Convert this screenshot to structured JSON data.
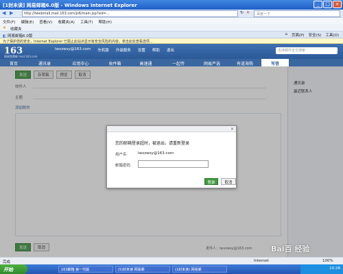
{
  "window": {
    "title": "[1封未读] 网易邮箱6.0版 - Windows Internet Explorer"
  },
  "address": {
    "url": "http://twebmail.mail.163.com/js6/main.jsp?sid=...",
    "search_placeholder": "百度一下"
  },
  "menu": [
    "文件(F)",
    "编辑(E)",
    "查看(V)",
    "收藏夹(A)",
    "工具(T)",
    "帮助(H)"
  ],
  "favorites": {
    "label": "收藏夹"
  },
  "tab": {
    "label": "网易邮箱6.0版"
  },
  "page_tools": [
    "页面(P)",
    "安全(S)",
    "工具(O)"
  ],
  "infobar": {
    "text": "为了保护您的安全，Internet Explorer 已阻止此站点显示有安全风险的内容。单击此处查看选项..."
  },
  "mail_header": {
    "logo": "163",
    "logo_sub": "网易免费邮 mail.163.com",
    "links": [
      "lwxzwsy@163.com",
      "车机版",
      "升级服务",
      "设置",
      "帮助",
      "退出"
    ],
    "search_placeholder": "支持邮件全文搜索"
  },
  "nav_tabs": [
    "首页",
    "通讯录",
    "应用中心",
    "收件箱",
    "高速通",
    "一起传",
    "网易严选",
    "有道海购",
    "写信"
  ],
  "compose": {
    "send": "发送",
    "save": "存草稿",
    "preview": "预览",
    "cancel": "取消",
    "to_label": "收件人",
    "subject_label": "主题",
    "attach_label": "添加附件",
    "sender_label": "发件人：",
    "sender_value": "lwxzwsy@163.com"
  },
  "sidebar": {
    "items": [
      "通讯录",
      "最近联系人"
    ]
  },
  "dialog": {
    "message": "您的邮箱登录超时，被退出，请重新登录",
    "user_label": "用户名",
    "user_value": "lwxzwsy@163.com",
    "password_label": "邮箱密码",
    "ok": "登录",
    "cancel": "取消"
  },
  "status": {
    "text": "完成",
    "zone": "Internet",
    "zoom": "100%"
  },
  "taskbar": {
    "start": "开始",
    "items": [
      "163邮箱 第一代版",
      "(5)封未读 网易邮",
      "(1封未读) 网易邮"
    ],
    "clock": "10:28"
  },
  "watermark": "Bai百 经验"
}
